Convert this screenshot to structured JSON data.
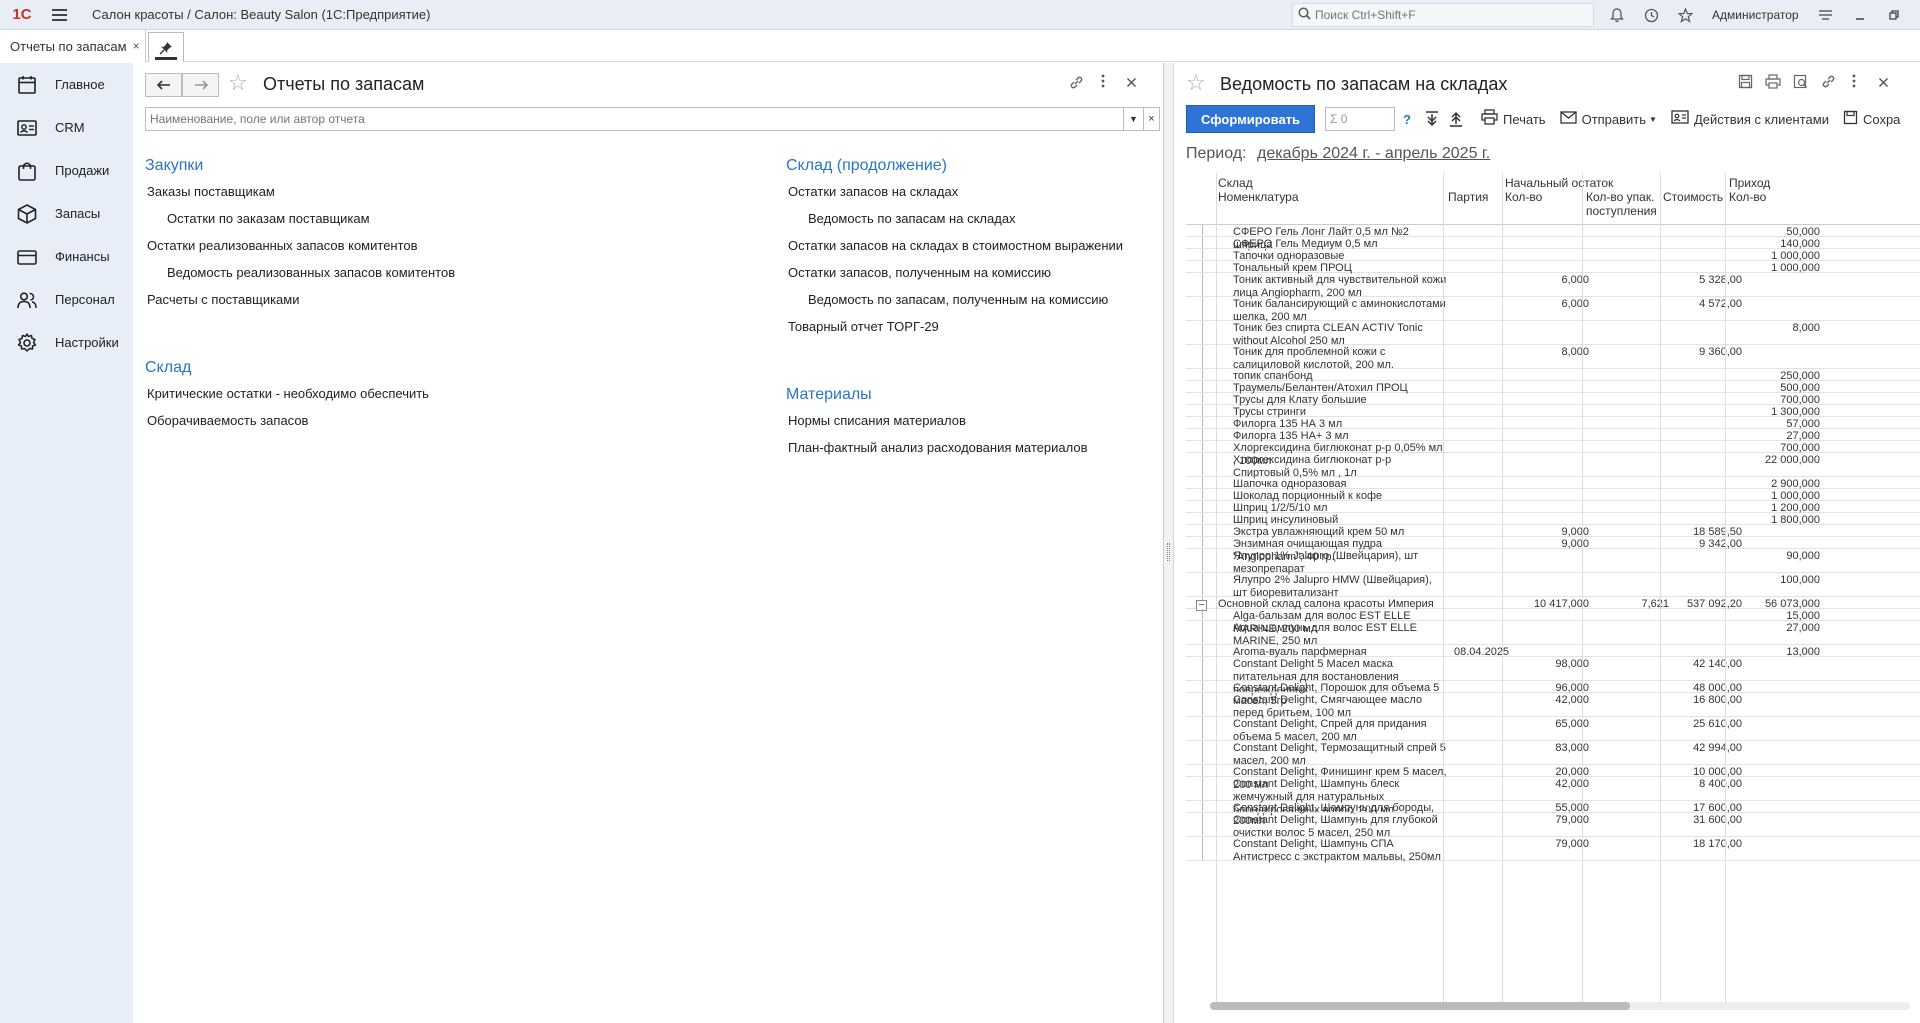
{
  "app": {
    "logo": "1С",
    "title": "Салон красоты / Салон: Beauty Salon  (1С:Предприятие)",
    "search_placeholder": "Поиск Ctrl+Shift+F",
    "user": "Администратор"
  },
  "tabs": {
    "doc_label": "Отчеты по запасам",
    "close": "×"
  },
  "sidebar": {
    "items": [
      {
        "label": "Главное",
        "icon": "calendar-icon"
      },
      {
        "label": "CRM",
        "icon": "contact-card-icon"
      },
      {
        "label": "Продажи",
        "icon": "shopping-bag-icon"
      },
      {
        "label": "Запасы",
        "icon": "box-icon"
      },
      {
        "label": "Финансы",
        "icon": "card-icon"
      },
      {
        "label": "Персонал",
        "icon": "people-icon"
      },
      {
        "label": "Настройки",
        "icon": "gear-icon"
      }
    ]
  },
  "left": {
    "title": "Отчеты по запасам",
    "filter_placeholder": "Наименование, поле или автор отчета",
    "sections": {
      "purchases": "Закупки",
      "warehouse_cont": "Склад (продолжение)",
      "warehouse": "Склад",
      "materials": "Материалы"
    },
    "links": {
      "orders_to_suppliers": "Заказы поставщикам",
      "balances_orders": "Остатки по заказам поставщикам",
      "balances_consignors": "Остатки реализованных запасов комитентов",
      "sheet_consignors": "Ведомость реализованных запасов комитентов",
      "settlements": "Расчеты с поставщиками",
      "critical": "Критические остатки - необходимо обеспечить",
      "turnover": "Оборачиваемость запасов",
      "stock_balances": "Остатки запасов на складах",
      "stock_sheet": "Ведомость по запасам на складах",
      "stock_value": "Остатки запасов на складах в стоимостном выражении",
      "commission_balances": "Остатки запасов, полученным на комиссию",
      "commission_sheet": "Ведомость по запасам, полученным на комиссию",
      "torg29": "Товарный отчет ТОРГ-29",
      "write_off_norms": "Нормы списания материалов",
      "plan_fact": "План-фактный анализ расходования материалов"
    }
  },
  "right": {
    "title": "Ведомость по запасам на складах",
    "generate": "Сформировать",
    "sum_placeholder": "Σ 0",
    "help": "?",
    "print": "Печать",
    "send": "Отправить",
    "client_actions": "Действия с клиентами",
    "save": "Сохра",
    "period_label": "Период:",
    "period_value": "декабрь 2024 г. - апрель 2025 г.",
    "headers": {
      "warehouse": "Склад",
      "item": "Номенклатура",
      "batch": "Партия",
      "opening": "Начальный остаток",
      "qty": "Кол-во",
      "qty_pack": "Кол-во упак. поступления",
      "cost": "Стоимость",
      "income": "Приход",
      "income_qty": "Кол-во"
    },
    "rows": [
      {
        "n": "СФЕРО Гель Лонг Лайт 0,5 мл №2 шприца",
        "b": "",
        "q": "",
        "p": "",
        "s": "",
        "i": "50,000",
        "h": 12
      },
      {
        "n": "СФЕРО Гель Медиум 0,5 мл",
        "b": "",
        "q": "",
        "p": "",
        "s": "",
        "i": "140,000",
        "h": 12
      },
      {
        "n": "Тапочки  одноразовые",
        "b": "",
        "q": "",
        "p": "",
        "s": "",
        "i": "1 000,000",
        "h": 12
      },
      {
        "n": "Тональный крем ПРОЦ",
        "b": "",
        "q": "",
        "p": "",
        "s": "",
        "i": "1 000,000",
        "h": 12
      },
      {
        "n": "Тоник активный для чувствительной кожи лица Angiopharm, 200 мл",
        "b": "",
        "q": "6,000",
        "p": "",
        "s": "5 328,00",
        "i": "",
        "h": 24
      },
      {
        "n": "Тоник балансирующий с аминокислотами шелка, 200 мл",
        "b": "",
        "q": "6,000",
        "p": "",
        "s": "4 572,00",
        "i": "",
        "h": 24
      },
      {
        "n": "Тоник без спирта CLEAN ACTIV Tonic without Alcohol 250 мл",
        "b": "",
        "q": "",
        "p": "",
        "s": "",
        "i": "8,000",
        "h": 24
      },
      {
        "n": "Тоник для проблемной кожи с салициловой кислотой, 200 мл.",
        "b": "",
        "q": "8,000",
        "p": "",
        "s": "9 360,00",
        "i": "",
        "h": 24
      },
      {
        "n": "топик спанбонд",
        "b": "",
        "q": "",
        "p": "",
        "s": "",
        "i": "250,000",
        "h": 12
      },
      {
        "n": "Траумель/Белантен/Атохил ПРОЦ",
        "b": "",
        "q": "",
        "p": "",
        "s": "",
        "i": "500,000",
        "h": 12
      },
      {
        "n": "Трусы для Клату большие",
        "b": "",
        "q": "",
        "p": "",
        "s": "",
        "i": "700,000",
        "h": 12
      },
      {
        "n": "Трусы стринги",
        "b": "",
        "q": "",
        "p": "",
        "s": "",
        "i": "1 300,000",
        "h": 12
      },
      {
        "n": "Филорга 135 НА 3 мл",
        "b": "",
        "q": "",
        "p": "",
        "s": "",
        "i": "57,000",
        "h": 12
      },
      {
        "n": "Филорга 135 НА+ 3 мл",
        "b": "",
        "q": "",
        "p": "",
        "s": "",
        "i": "27,000",
        "h": 12
      },
      {
        "n": "Хлоргексидина биглюконат р-р 0,05% мл , 100мл",
        "b": "",
        "q": "",
        "p": "",
        "s": "",
        "i": "700,000",
        "h": 12
      },
      {
        "n": "Хлоргексидина биглюконат р-р Спиртовый 0,5% мл , 1л",
        "b": "",
        "q": "",
        "p": "",
        "s": "",
        "i": "22 000,000",
        "h": 24
      },
      {
        "n": "Шапочка одноразовая",
        "b": "",
        "q": "",
        "p": "",
        "s": "",
        "i": "2 900,000",
        "h": 12
      },
      {
        "n": "Шоколад порционный к кофе",
        "b": "",
        "q": "",
        "p": "",
        "s": "",
        "i": "1 000,000",
        "h": 12
      },
      {
        "n": "Шприц 1/2/5/10 мл",
        "b": "",
        "q": "",
        "p": "",
        "s": "",
        "i": "1 200,000",
        "h": 12
      },
      {
        "n": "Шприц инсулиновый",
        "b": "",
        "q": "",
        "p": "",
        "s": "",
        "i": "1 800,000",
        "h": 12
      },
      {
        "n": "Экстра увлажняющий крем 50 мл",
        "b": "",
        "q": "9,000",
        "p": "",
        "s": "18 589,50",
        "i": "",
        "h": 12
      },
      {
        "n": "Энзимная очищающая пудра \"Angiopharm\", 40 гр.",
        "b": "",
        "q": "9,000",
        "p": "",
        "s": "9 342,00",
        "i": "",
        "h": 12
      },
      {
        "n": "Ялупро 1% Jalupro (Швейцария), шт мезопрепарат",
        "b": "",
        "q": "",
        "p": "",
        "s": "",
        "i": "90,000",
        "h": 24
      },
      {
        "n": "Ялупро 2% Jalupro HMW (Швейцария), шт биоревитализант",
        "b": "",
        "q": "",
        "p": "",
        "s": "",
        "i": "100,000",
        "h": 24
      },
      {
        "n": "Основной склад салона красоты Империя",
        "b": "",
        "q": "10 417,000",
        "p": "7,621",
        "s": "537 092,20",
        "i": "56 073,000",
        "h": 12,
        "group": true
      },
      {
        "n": "Alga-бальзам для волос EST ELLE MARINE, 200 мл",
        "b": "",
        "q": "",
        "p": "",
        "s": "",
        "i": "15,000",
        "h": 12
      },
      {
        "n": "Aqua-шампунь для волос EST ELLE MARINE, 250 мл",
        "b": "",
        "q": "",
        "p": "",
        "s": "",
        "i": "27,000",
        "h": 24
      },
      {
        "n": "Aroma-вуаль парфмерная",
        "b": "08.04.2025",
        "q": "",
        "p": "",
        "s": "",
        "i": "13,000",
        "h": 12
      },
      {
        "n": "Constant Delight 5 Масел маска питательная для востановления поврежденных",
        "b": "",
        "q": "98,000",
        "p": "",
        "s": "42 140,00",
        "i": "",
        "h": 24
      },
      {
        "n": "Constant Delight, Порошок для объема 5 масел, 5гр",
        "b": "",
        "q": "96,000",
        "p": "",
        "s": "48 000,00",
        "i": "",
        "h": 12
      },
      {
        "n": "Constant Delight, Смягчающее масло перед бритьем, 100 мл",
        "b": "",
        "q": "42,000",
        "p": "",
        "s": "16 800,00",
        "i": "",
        "h": 24
      },
      {
        "n": "Constant Delight, Спрей для придания объема 5 масел, 200 мл",
        "b": "",
        "q": "65,000",
        "p": "",
        "s": "25 610,00",
        "i": "",
        "h": 24
      },
      {
        "n": "Constant Delight, Термозащитный спрей 5 масел, 200 мл",
        "b": "",
        "q": "83,000",
        "p": "",
        "s": "42 994,00",
        "i": "",
        "h": 24
      },
      {
        "n": "Constant Delight, Финишинг крем 5 масел, 200 мл",
        "b": "",
        "q": "20,000",
        "p": "",
        "s": "10 000,00",
        "i": "",
        "h": 12
      },
      {
        "n": "Constant Delight, Шампунь блеск жемчужный для натуральных блондированных волос, 200 мл",
        "b": "",
        "q": "42,000",
        "p": "",
        "s": "8 400,00",
        "i": "",
        "h": 24
      },
      {
        "n": "Constant Delight, Шампунь для бороды, 200мл",
        "b": "",
        "q": "55,000",
        "p": "",
        "s": "17 600,00",
        "i": "",
        "h": 12
      },
      {
        "n": "Constant Delight, Шампунь для глубокой очистки волос 5 масел, 250 мл",
        "b": "",
        "q": "79,000",
        "p": "",
        "s": "31 600,00",
        "i": "",
        "h": 24
      },
      {
        "n": "Constant Delight, Шампунь СПА Антистресс с экстрактом мальвы, 250мл",
        "b": "",
        "q": "79,000",
        "p": "",
        "s": "18 170,00",
        "i": "",
        "h": 24
      }
    ]
  }
}
